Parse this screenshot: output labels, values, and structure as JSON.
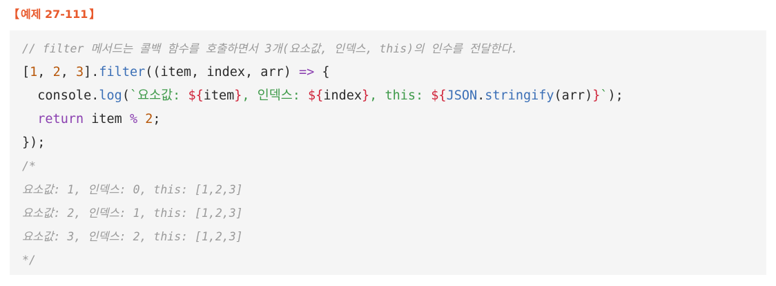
{
  "heading": {
    "open_bracket": "【",
    "title": "예제 27-111",
    "close_bracket": "】"
  },
  "code": {
    "comment_line": "// filter 메서드는 콜백 함수를 호출하면서 3개(요소값, 인덱스, this)의 인수를 전달한다.",
    "line2": {
      "p1": "[",
      "n1": "1",
      "p2": ", ",
      "n2": "2",
      "p3": ", ",
      "n3": "3",
      "p4": "].",
      "fn": "filter",
      "p5": "((item, index, arr) ",
      "arrow": "=>",
      "p6": " {"
    },
    "line3": {
      "indent": "  ",
      "obj": "console",
      "dot": ".",
      "fn": "log",
      "open": "(",
      "str1": "`요소값: ",
      "t1o": "${",
      "v1": "item",
      "t1c": "}",
      "str2": ", 인덱스: ",
      "t2o": "${",
      "v2": "index",
      "t2c": "}",
      "str3": ", this: ",
      "t3o": "${",
      "obj2": "JSON",
      "dot2": ".",
      "fn2": "stringify",
      "arg": "(arr)",
      "t3c": "}",
      "str4": "`",
      "close": ");"
    },
    "line4": {
      "indent": "  ",
      "kw": "return",
      "p1": " item ",
      "op": "%",
      "p2": " ",
      "num": "2",
      "p3": ";"
    },
    "line5": "});",
    "out_open": "/*",
    "outputs": [
      "요소값: 1, 인덱스: 0, this: [1,2,3]",
      "요소값: 2, 인덱스: 1, this: [1,2,3]",
      "요소값: 3, 인덱스: 2, this: [1,2,3]"
    ],
    "out_close": "*/"
  }
}
